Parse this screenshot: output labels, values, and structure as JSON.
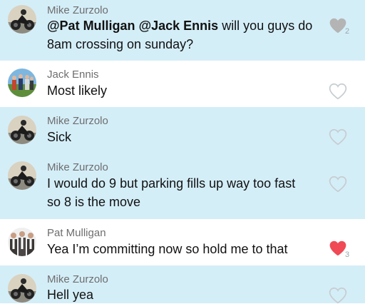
{
  "colors": {
    "row_highlight": "#d4eef8",
    "heart_liked_gray": "#b4b4b4",
    "heart_liked_red": "#ef4a55",
    "heart_outline": "#c7cdd1"
  },
  "messages": [
    {
      "sender": "Mike Zurzolo",
      "avatar_icon": "photo-avatar-biker",
      "mention1": "@Pat Mulligan",
      "mention2": "@Jack Ennis",
      "text": " will you guys do 8am crossing on sunday?",
      "like_icon": "heart-filled-gray-icon",
      "like_count": "2"
    },
    {
      "sender": "Jack Ennis",
      "avatar_icon": "photo-avatar-group",
      "text": "Most likely",
      "like_icon": "heart-outline-icon"
    },
    {
      "sender": "Mike Zurzolo",
      "avatar_icon": "photo-avatar-biker",
      "text": "Sick",
      "like_icon": "heart-outline-icon"
    },
    {
      "sender": "Mike Zurzolo",
      "avatar_icon": "photo-avatar-biker",
      "text": "I would do 9 but parking fills up way too fast so 8 is the move",
      "like_icon": "heart-outline-icon"
    },
    {
      "sender": "Pat Mulligan",
      "avatar_icon": "photo-avatar-suits",
      "text": "Yea I’m committing now so hold me to that",
      "like_icon": "heart-filled-red-icon",
      "like_count": "3"
    },
    {
      "sender": "Mike Zurzolo",
      "avatar_icon": "photo-avatar-biker",
      "text": "Hell yea",
      "like_icon": "heart-outline-icon"
    }
  ]
}
